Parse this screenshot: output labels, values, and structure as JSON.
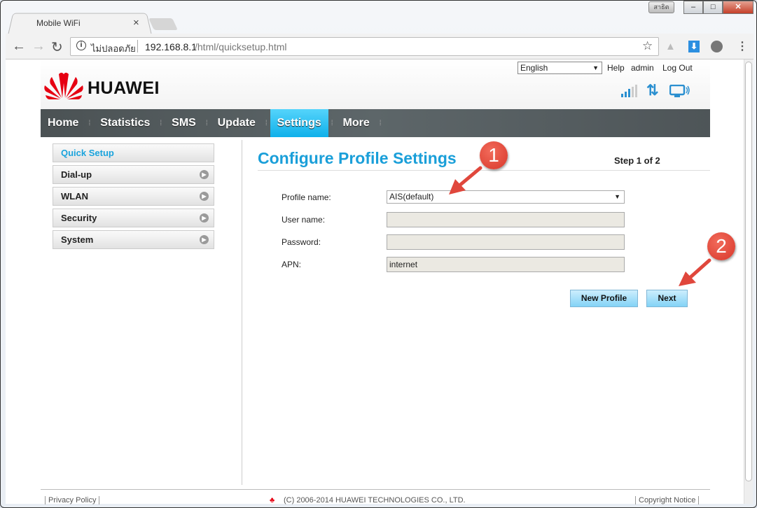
{
  "browser": {
    "tab_title": "Mobile WiFi",
    "security_label": "ไม่ปลอดภัย",
    "url_host": "192.168.8.1",
    "url_path": "/html/quicksetup.html",
    "lang_indicator": "สาธิต"
  },
  "topbar": {
    "language": "English",
    "help": "Help",
    "user": "admin",
    "logout": "Log Out"
  },
  "brand": {
    "name": "HUAWEI",
    "color": "#e60012"
  },
  "nav": {
    "items": [
      "Home",
      "Statistics",
      "SMS",
      "Update",
      "Settings",
      "More"
    ],
    "active": "Settings",
    "accent": "#19b6ee"
  },
  "sidebar": {
    "items": [
      {
        "label": "Quick Setup",
        "active": true
      },
      {
        "label": "Dial-up"
      },
      {
        "label": "WLAN"
      },
      {
        "label": "Security"
      },
      {
        "label": "System"
      }
    ]
  },
  "main": {
    "title": "Configure Profile Settings",
    "step": "Step 1 of 2",
    "fields": [
      {
        "label": "Profile name:",
        "value": "AIS(default)",
        "type": "select"
      },
      {
        "label": "User name:",
        "value": ""
      },
      {
        "label": "Password:",
        "value": ""
      },
      {
        "label": "APN:",
        "value": "internet"
      }
    ],
    "new_profile": "New Profile",
    "next": "Next"
  },
  "annotations": [
    "1",
    "2"
  ],
  "footer": {
    "privacy": "Privacy Policy",
    "copyright": "(C) 2006-2014 HUAWEI TECHNOLOGIES CO., LTD.",
    "notice": "Copyright Notice"
  }
}
